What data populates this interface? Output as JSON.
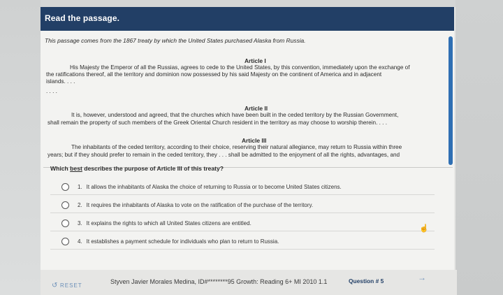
{
  "header": {
    "title": "Read the passage."
  },
  "passage": {
    "intro": "This passage comes from the 1867 treaty by which the United States purchased Alaska from Russia.",
    "article1": {
      "heading": "Article I",
      "line1": "His Majesty the Emperor of all the Russias, agrees to cede to the United States, by this convention, immediately upon the exchange of",
      "line2": "the ratifications thereof, all the territory and dominion now possessed by his said Majesty on the continent of America and in adjacent",
      "line3": "islands. . . .",
      "ellipsis": ". . . ."
    },
    "article2": {
      "heading": "Article II",
      "line1": "It is, however, understood and agreed, that the churches which have been built in the ceded territory by the Russian Government,",
      "line2": "shall remain the property of such members of the Greek Oriental Church resident in the territory as may choose to worship therein. . . ."
    },
    "article3": {
      "heading": "Article III",
      "line1": "The inhabitants of the ceded territory, according to their choice, reserving their natural allegiance, may return to Russia within three",
      "line2": "years; but if they should prefer to remain in the ceded territory, they . . . shall be admitted to the enjoyment of all the rights, advantages, and"
    }
  },
  "question": {
    "text_before": "Which ",
    "text_underlined": "best",
    "text_after": " describes the purpose of Article III of this treaty?"
  },
  "options": [
    {
      "num": "1.",
      "text": "It allows the inhabitants of Alaska the choice of returning to Russia or to become United States citizens."
    },
    {
      "num": "2.",
      "text": "It requires the inhabitants of Alaska to vote on the ratification of the purchase of the territory."
    },
    {
      "num": "3.",
      "text": "It explains the rights to which all United States citizens are entitled."
    },
    {
      "num": "4.",
      "text": "It establishes a payment schedule for individuals who plan to return to Russia."
    }
  ],
  "footer": {
    "reset_label": "RESET",
    "student_info": "Styven Javier Morales Medina, ID#********95  Growth: Reading 6+ MI 2010 1.1",
    "question_number": "Question # 5",
    "next_arrow": "→"
  },
  "colors": {
    "header_bg": "#223f66",
    "accent": "#2f6fb3"
  },
  "icons": {
    "reset": "reset-icon",
    "next": "arrow-right-icon",
    "cursor": "hand-pointer-icon"
  }
}
